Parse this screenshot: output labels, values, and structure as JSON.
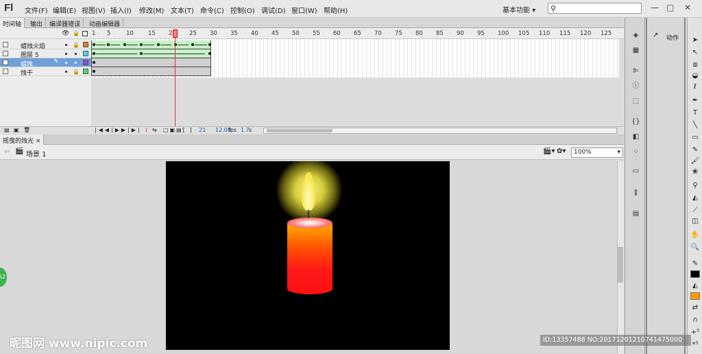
{
  "app": {
    "logo": "Fl"
  },
  "menu": [
    "文件(F)",
    "编辑(E)",
    "视图(V)",
    "插入(I)",
    "修改(M)",
    "文本(T)",
    "命令(C)",
    "控制(O)",
    "调试(D)",
    "窗口(W)",
    "帮助(H)"
  ],
  "workspace": {
    "label": "基本功能",
    "chevron": "▾"
  },
  "search": {
    "icon": "search-icon",
    "placeholder": ""
  },
  "window_controls": {
    "minimize": "—",
    "restore": "□",
    "close": "✕"
  },
  "timeline_tabs": [
    "时间轴",
    "输出",
    "编译器错误",
    "动画编辑器"
  ],
  "frame_numbers": [
    "1",
    "5",
    "10",
    "15",
    "20",
    "25",
    "30",
    "35",
    "40",
    "45",
    "50",
    "55",
    "60",
    "65",
    "70",
    "75",
    "80",
    "85",
    "90",
    "95",
    "100",
    "105",
    "110",
    "115",
    "120",
    "125"
  ],
  "layers": [
    {
      "name": "蜡烛火焰",
      "color": "#f07820",
      "selected": false
    },
    {
      "name": "图层 5",
      "color": "#40d8f0",
      "selected": false
    },
    {
      "name": "蜡烛",
      "color": "#a040e0",
      "selected": true
    },
    {
      "name": "烛干",
      "color": "#40e060",
      "selected": false
    }
  ],
  "timeline_footer": {
    "current_frame": "21",
    "fps": "12.00",
    "fps_unit": "fps",
    "time": "1.7",
    "time_unit": "s"
  },
  "document_tab": {
    "title": "摇曳的烛光",
    "close": "×"
  },
  "scene": {
    "label": "场景 1"
  },
  "zoom": {
    "value": "100%"
  },
  "action_panel": {
    "label": "动作"
  },
  "colors": {
    "stroke": "#000000",
    "fill": "#ff9900",
    "stage": "#000000"
  },
  "watermark": {
    "left": "昵图网 www.nipic.com",
    "right": "ID:13357488 NO:20171201210741475000"
  },
  "side_badge": "52"
}
